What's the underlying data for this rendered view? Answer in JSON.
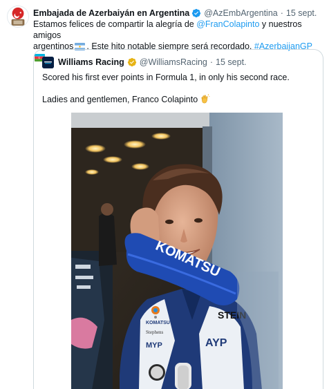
{
  "tweet": {
    "author_name": "Embajada de Azerbaiyán en Argentina",
    "handle": "@AzEmbArgentina",
    "date": "15 sept.",
    "text_1": "Estamos felices de compartir la alegría de ",
    "mention": "@FranColapinto",
    "text_2": " y nuestros amigos",
    "text_3": "argentinos",
    "text_4": ". Este hito notable siempre será recordado. ",
    "hashtag": "#AzerbaijanGP",
    "flags": [
      "argentina-flag",
      "azerbaijan-flag"
    ],
    "colors": {
      "link": "#1d9bf0",
      "verified": "#1d9bf0",
      "muted": "#536471"
    }
  },
  "quoted": {
    "author_name": "Williams Racing",
    "handle": "@WilliamsRacing",
    "date": "15 sept.",
    "text_line1": "Scored his first ever points in Formula 1, in only his second race.",
    "text_line2": "Ladies and gentlemen, Franco Colapinto",
    "emoji": "clapping-hands-icon",
    "badge_color": "#e7b416",
    "photo_lettering": {
      "sleeve": "KOMATSU",
      "chest_right": "STEIN",
      "lower_right": "AYP",
      "chest_left_1": "KOMATSU",
      "chest_left_2": "Stephens",
      "chest_left_3": "MYP"
    }
  }
}
